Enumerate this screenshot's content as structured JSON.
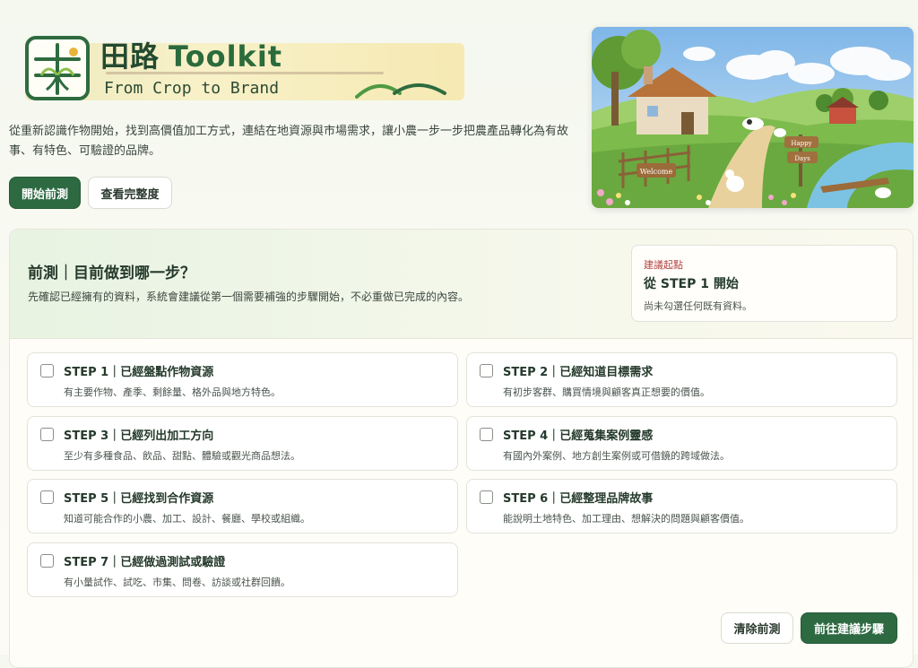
{
  "brand": {
    "title_cn": "田路",
    "title_en": "Toolkit",
    "subtitle": "From Crop to Brand"
  },
  "hero": {
    "description": "從重新認識作物開始，找到高價值加工方式，連結在地資源與市場需求，讓小農一步一步把農產品轉化為有故事、有特色、可驗證的品牌。",
    "start_button": "開始前測",
    "view_button": "查看完整度",
    "sign_top": "Happy",
    "sign_bottom": "Days",
    "sign_gate": "Welcome"
  },
  "pretest": {
    "title": "前測｜目前做到哪一步？",
    "description": "先確認已經擁有的資料，系統會建議從第一個需要補強的步驟開始，不必重做已完成的內容。",
    "suggestion": {
      "label": "建議起點",
      "value": "從 STEP 1 開始",
      "note": "尚未勾選任何既有資料。"
    },
    "steps": [
      {
        "title": "STEP 1｜已經盤點作物資源",
        "desc": "有主要作物、產季、剩餘量、格外品與地方特色。",
        "checked": false
      },
      {
        "title": "STEP 2｜已經知道目標需求",
        "desc": "有初步客群、購買情境與顧客真正想要的價值。",
        "checked": false
      },
      {
        "title": "STEP 3｜已經列出加工方向",
        "desc": "至少有多種食品、飲品、甜點、體驗或觀光商品想法。",
        "checked": false
      },
      {
        "title": "STEP 4｜已經蒐集案例靈感",
        "desc": "有國內外案例、地方創生案例或可借鏡的跨域做法。",
        "checked": false
      },
      {
        "title": "STEP 5｜已經找到合作資源",
        "desc": "知道可能合作的小農、加工、設計、餐廳、學校或組織。",
        "checked": false
      },
      {
        "title": "STEP 6｜已經整理品牌故事",
        "desc": "能說明土地特色、加工理由、想解決的問題與顧客價值。",
        "checked": false
      },
      {
        "title": "STEP 7｜已經做過測試或驗證",
        "desc": "有小量試作、試吃、市集、問卷、訪談或社群回饋。",
        "checked": false
      }
    ],
    "clear_button": "清除前測",
    "go_button": "前往建議步驟"
  },
  "colors": {
    "primary": "#2d6a41",
    "accent_label": "#b34040"
  }
}
